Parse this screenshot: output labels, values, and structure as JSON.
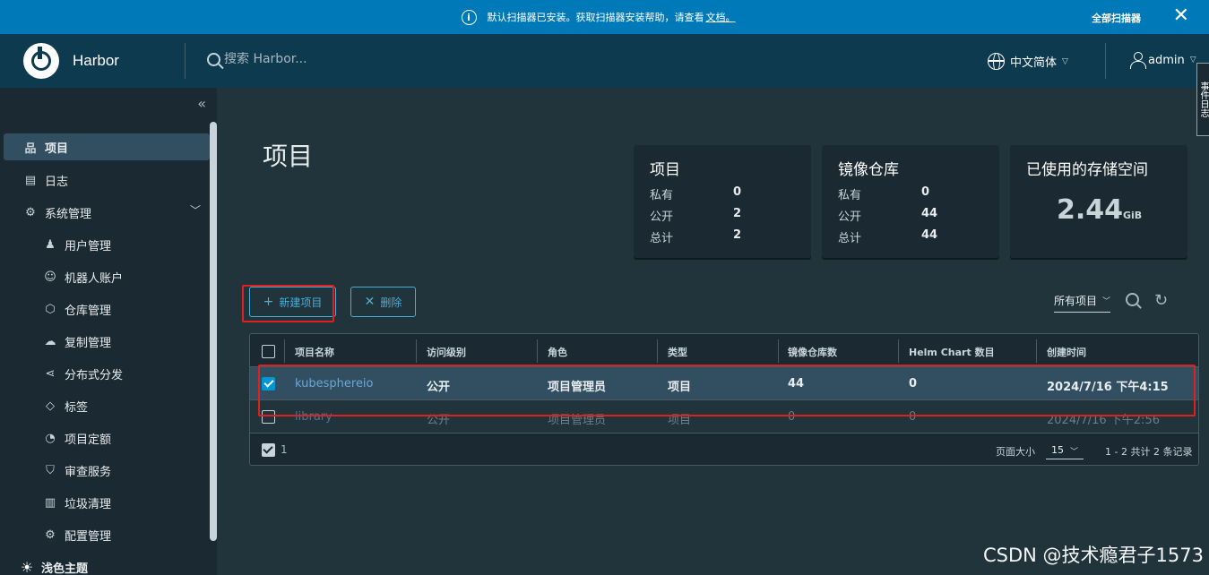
{
  "banner": {
    "message": "默认扫描器已安装。获取扫描器安装帮助，请查看",
    "doc_link": "文档。",
    "all_scanners": "全部扫描器",
    "close": "✕"
  },
  "header": {
    "brand": "Harbor",
    "search_placeholder": "搜索 Harbor...",
    "language": "中文简体",
    "user": "admin"
  },
  "side_tab_label": "事件日志",
  "sidebar": {
    "collapse": "«",
    "items": [
      {
        "label": "项目",
        "icon": "项",
        "active": true
      },
      {
        "label": "日志",
        "icon": "▤"
      },
      {
        "label": "系统管理",
        "icon": "⚙",
        "expandable": true
      },
      {
        "label": "用户管理",
        "icon": "♟",
        "sub": true
      },
      {
        "label": "机器人账户",
        "icon": "☺",
        "sub": true
      },
      {
        "label": "仓库管理",
        "icon": "⬡",
        "sub": true
      },
      {
        "label": "复制管理",
        "icon": "☁",
        "sub": true
      },
      {
        "label": "分布式分发",
        "icon": "⋖",
        "sub": true
      },
      {
        "label": "标签",
        "icon": "◇",
        "sub": true
      },
      {
        "label": "项目定额",
        "icon": "◔",
        "sub": true
      },
      {
        "label": "审查服务",
        "icon": "⛉",
        "sub": true
      },
      {
        "label": "垃圾清理",
        "icon": "▥",
        "sub": true
      },
      {
        "label": "配置管理",
        "icon": "⚙",
        "sub": true
      },
      {
        "label": "浅色主题",
        "icon": "☀"
      }
    ]
  },
  "main": {
    "title": "项目",
    "cards": {
      "projects": {
        "title": "项目",
        "private_label": "私有",
        "private": "0",
        "public_label": "公开",
        "public": "2",
        "total_label": "总计",
        "total": "2"
      },
      "repos": {
        "title": "镜像仓库",
        "private_label": "私有",
        "private": "0",
        "public_label": "公开",
        "public": "44",
        "total_label": "总计",
        "total": "44"
      },
      "storage": {
        "title": "已使用的存储空间",
        "value": "2.44",
        "unit": "GiB"
      }
    },
    "new_project": "新建项目",
    "delete": "删除",
    "filter": "所有项目",
    "columns": [
      "项目名称",
      "访问级别",
      "角色",
      "类型",
      "镜像仓库数",
      "Helm Chart 数目",
      "创建时间"
    ],
    "rows": [
      {
        "name": "kubesphereio",
        "access": "公开",
        "role": "项目管理员",
        "type": "项目",
        "repos": "44",
        "charts": "0",
        "created": "2024/7/16 下午4:15",
        "selected": true
      },
      {
        "name": "library",
        "access": "公开",
        "role": "项目管理员",
        "type": "项目",
        "repos": "0",
        "charts": "0",
        "created": "2024/7/16 下午2:56",
        "selected": false
      }
    ],
    "footer": {
      "selected_count": "1",
      "page_size_label": "页面大小",
      "page_size": "15",
      "page_info": "1 - 2 共计 2 条记录"
    }
  },
  "watermark": "CSDN @技术瘾君子1573"
}
